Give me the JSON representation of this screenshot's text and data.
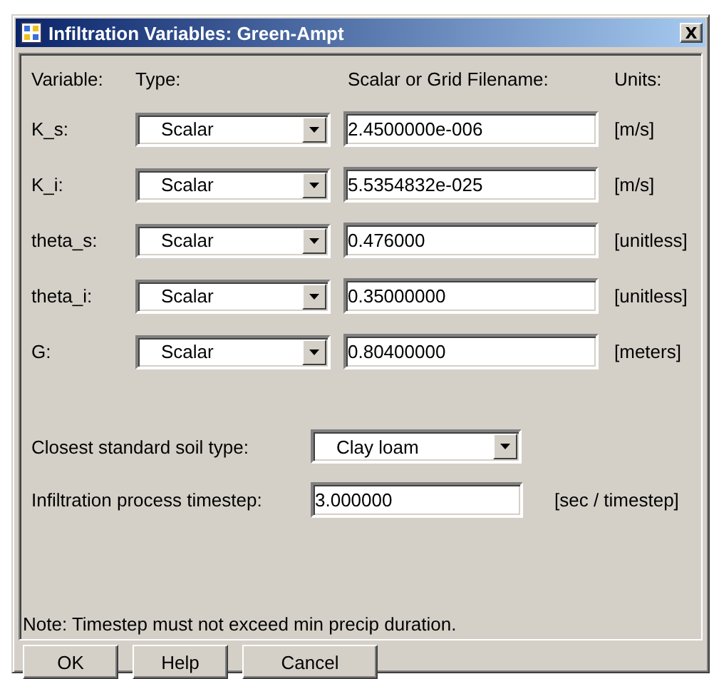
{
  "window": {
    "title": "Infiltration Variables: Green-Ampt",
    "close": "X"
  },
  "headers": {
    "variable": "Variable:",
    "type": "Type:",
    "value": "Scalar or Grid Filename:",
    "units": "Units:"
  },
  "variables": [
    {
      "name": "K_s:",
      "type": "Scalar",
      "value": "2.4500000e-006",
      "units": "[m/s]"
    },
    {
      "name": "K_i:",
      "type": "Scalar",
      "value": "5.5354832e-025",
      "units": "[m/s]"
    },
    {
      "name": "theta_s:",
      "type": "Scalar",
      "value": "0.476000",
      "units": "[unitless]"
    },
    {
      "name": "theta_i:",
      "type": "Scalar",
      "value": "0.35000000",
      "units": "[unitless]"
    },
    {
      "name": "G:",
      "type": "Scalar",
      "value": "0.80400000",
      "units": "[meters]"
    }
  ],
  "soil_type": {
    "label": "Closest standard soil type:",
    "value": "Clay loam"
  },
  "timestep": {
    "label": "Infiltration process timestep:",
    "value": "3.000000",
    "units": "[sec / timestep]"
  },
  "note": "Note: Timestep must not exceed min precip duration.",
  "buttons": [
    "OK",
    "Help",
    "Cancel"
  ]
}
